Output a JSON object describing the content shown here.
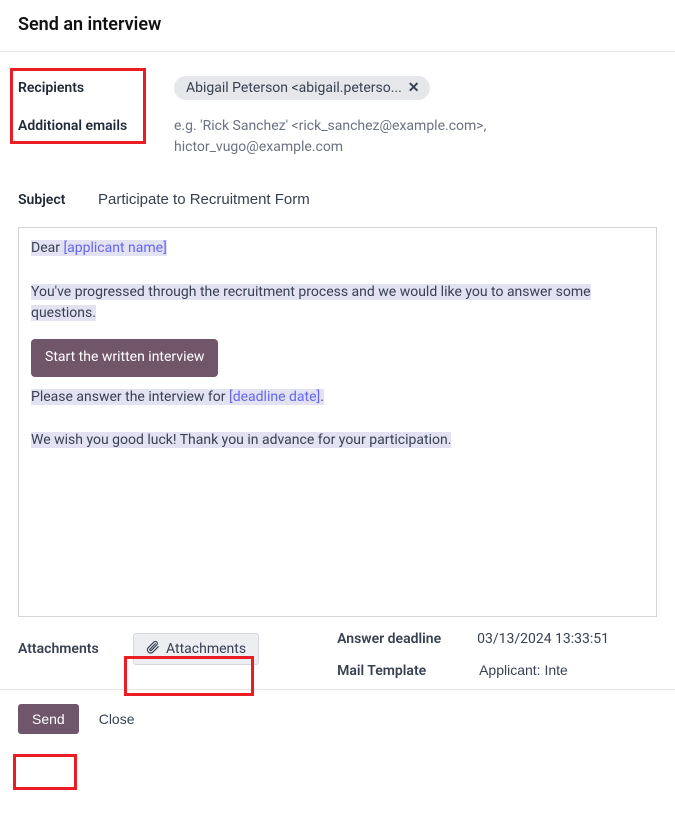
{
  "modal": {
    "title": "Send an interview"
  },
  "form": {
    "labels": {
      "recipients": "Recipients",
      "additional_emails": "Additional emails",
      "subject": "Subject",
      "attachments": "Attachments",
      "answer_deadline": "Answer deadline",
      "mail_template": "Mail Template"
    },
    "recipients": [
      {
        "display": "Abigail Peterson <abigail.peterso..."
      }
    ],
    "additional_emails_placeholder": "e.g.  'Rick Sanchez' <rick_sanchez@example.com>, hictor_vugo@example.com",
    "subject_value": "Participate to Recruitment Form",
    "body": {
      "greeting_prefix": "Dear ",
      "greeting_token": "[applicant name]",
      "p1": "You've progressed through the recruitment process and we would like you to answer some questions.",
      "start_button": "Start the written interview",
      "p2_prefix": "Please answer the interview for ",
      "p2_token": "[deadline date]",
      "p2_suffix": ".",
      "p3": "We wish you good luck! Thank you in advance for your participation."
    },
    "attachments_button": "Attachments",
    "answer_deadline_value": "03/13/2024 13:33:51",
    "mail_template_value": "Applicant: Inte"
  },
  "footer": {
    "send": "Send",
    "close": "Close"
  },
  "icons": {
    "remove_tag": "✕",
    "clip": "📎"
  }
}
